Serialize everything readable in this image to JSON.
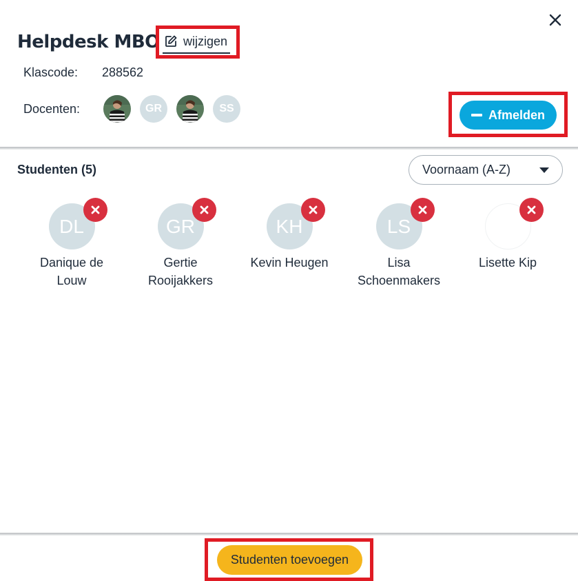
{
  "header": {
    "title": "Helpdesk MBO",
    "edit_label": "wijzigen",
    "close_icon": "close-icon"
  },
  "class_info": {
    "class_code_label": "Klascode:",
    "class_code_value": "288562",
    "teachers_label": "Docenten:",
    "teachers": [
      {
        "type": "photo",
        "initials": ""
      },
      {
        "type": "initials",
        "initials": "GR"
      },
      {
        "type": "photo",
        "initials": ""
      },
      {
        "type": "initials",
        "initials": "SS"
      }
    ],
    "signout_label": "Afmelden"
  },
  "students": {
    "title": "Studenten (5)",
    "sort_selected": "Voornaam (A-Z)",
    "items": [
      {
        "initials": "DL",
        "name": "Danique de Louw"
      },
      {
        "initials": "GR",
        "name": "Gertie Rooijakkers"
      },
      {
        "initials": "KH",
        "name": "Kevin Heugen"
      },
      {
        "initials": "LS",
        "name": "Lisa Schoenmakers"
      },
      {
        "initials": "",
        "name": "Lisette Kip"
      }
    ]
  },
  "footer": {
    "add_label": "Studenten toevoegen"
  },
  "colors": {
    "accent_blue": "#0aa7dd",
    "remove_red": "#d8303f",
    "add_yellow": "#f5b51c",
    "highlight_red": "#e01b24",
    "avatar_bg": "#d3dfe4"
  }
}
